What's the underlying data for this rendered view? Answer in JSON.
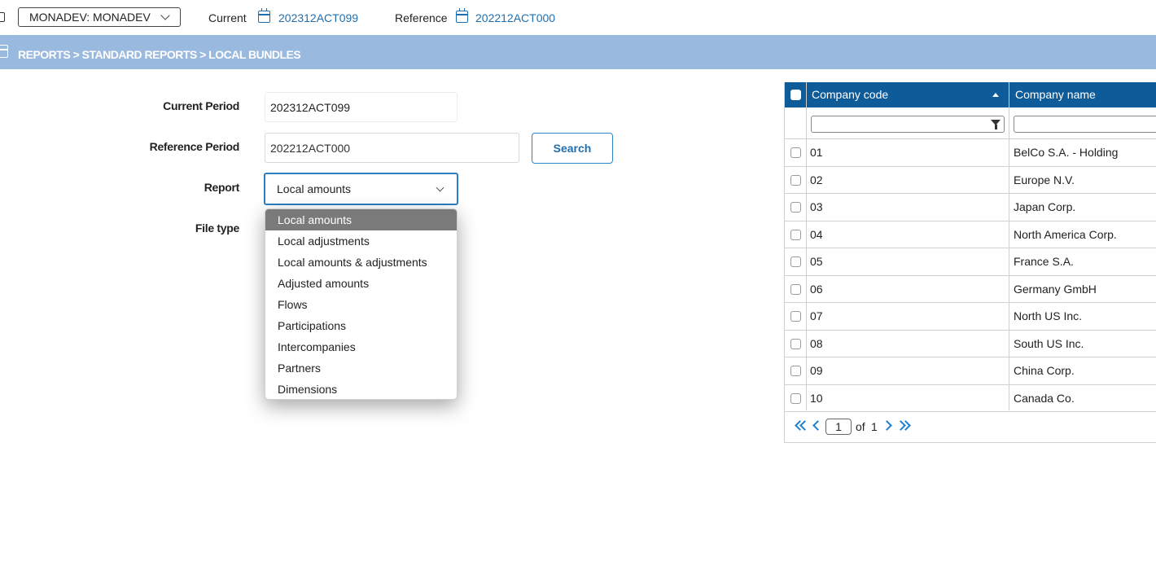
{
  "header": {
    "environment": "MONADEV: MONADEV",
    "current_label": "Current",
    "current_period": "202312ACT099",
    "reference_label": "Reference",
    "reference_period": "202212ACT000"
  },
  "breadcrumb": "REPORTS > STANDARD REPORTS > LOCAL BUNDLES",
  "form": {
    "current_period_label": "Current Period",
    "current_period_value": "202312ACT099",
    "reference_period_label": "Reference Period",
    "reference_period_value": "202212ACT000",
    "search_label": "Search",
    "report_label": "Report",
    "report_value": "Local amounts",
    "file_type_label": "File type"
  },
  "dropdown": {
    "options": [
      "Local amounts",
      "Local adjustments",
      "Local amounts & adjustments",
      "Adjusted amounts",
      "Flows",
      "Participations",
      "Intercompanies",
      "Partners",
      "Dimensions"
    ],
    "selected": "Local amounts"
  },
  "grid": {
    "columns": [
      "Company code",
      "Company name"
    ],
    "rows": [
      {
        "code": "01",
        "name": "BelCo S.A. - Holding"
      },
      {
        "code": "02",
        "name": "Europe N.V."
      },
      {
        "code": "03",
        "name": "Japan Corp."
      },
      {
        "code": "04",
        "name": "North America Corp."
      },
      {
        "code": "05",
        "name": "France S.A."
      },
      {
        "code": "06",
        "name": "Germany GmbH"
      },
      {
        "code": "07",
        "name": "North US Inc."
      },
      {
        "code": "08",
        "name": "South US Inc."
      },
      {
        "code": "09",
        "name": "China Corp."
      },
      {
        "code": "10",
        "name": "Canada Co."
      }
    ],
    "pager": {
      "page": "1",
      "of_label": "of",
      "total": "1"
    }
  },
  "colors": {
    "band": "#9ab9de",
    "grid_header": "#0e5b9a",
    "link": "#1f6fb0",
    "selected_option": "#7a7a7a"
  },
  "icons": [
    "calendar-icon",
    "chevron-down-icon",
    "sort-ascending-icon",
    "filter-icon",
    "first-page-icon",
    "previous-page-icon",
    "next-page-icon",
    "last-page-icon"
  ]
}
